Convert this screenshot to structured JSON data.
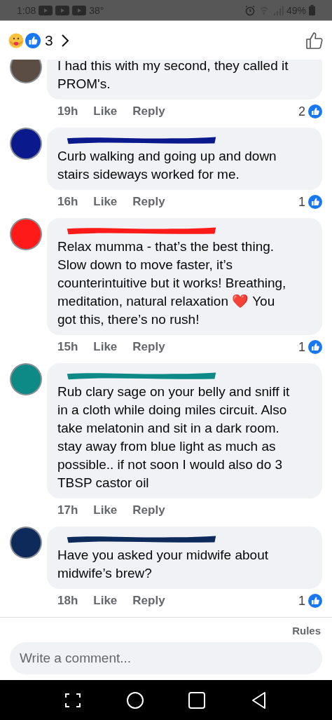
{
  "status_bar": {
    "time": "1:08",
    "temperature": "38°",
    "battery": "49%"
  },
  "header": {
    "reaction_count": "3"
  },
  "comments": [
    {
      "text": "I had this with my second, they called it PROM's.",
      "time": "19h",
      "like": "Like",
      "reply": "Reply",
      "reactions": "2"
    },
    {
      "text": "Curb walking and going up and down stairs sideways worked for me.",
      "time": "16h",
      "like": "Like",
      "reply": "Reply",
      "reactions": "1",
      "color": "#0a1a8c"
    },
    {
      "text": "Relax mumma - that’s the best thing. Slow down to move faster, it’s counterintuitive but it works! Breathing, meditation, natural relaxation ❤️ You got this, there’s no rush!",
      "time": "15h",
      "like": "Like",
      "reply": "Reply",
      "reactions": "1",
      "color": "#ff1a1a"
    },
    {
      "text": "Rub clary sage on your belly and sniff it in a cloth while doing miles circuit. Also take melatonin and sit in a dark room. stay away from blue light as much as possible.. if not soon I would also do 3 TBSP castor oil",
      "time": "17h",
      "like": "Like",
      "reply": "Reply",
      "color": "#0e8a86"
    },
    {
      "text": "Have you asked your midwife about midwife’s brew?",
      "time": "18h",
      "like": "Like",
      "reply": "Reply",
      "reactions": "1",
      "color": "#0d2a5a"
    }
  ],
  "footer": {
    "rules": "Rules",
    "placeholder": "Write a comment..."
  }
}
